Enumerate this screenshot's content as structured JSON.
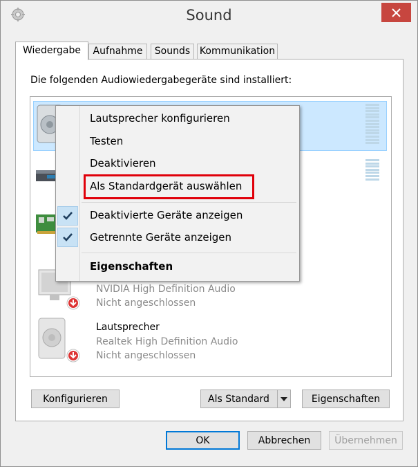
{
  "window": {
    "title": "Sound"
  },
  "tabs": [
    {
      "label": "Wiedergabe",
      "active": true
    },
    {
      "label": "Aufnahme"
    },
    {
      "label": "Sounds"
    },
    {
      "label": "Kommunikation"
    }
  ],
  "panel": {
    "description": "Die folgenden Audiowiedergabegeräte sind installiert:"
  },
  "devices": [
    {
      "name": "Lautsprecher",
      "vendor": "NVIDIA High Definition Audio",
      "status": "Nicht angeschlossen",
      "icon": "monitor-speaker-icon"
    },
    {
      "name": "Lautsprecher",
      "vendor": "Realtek High Definition Audio",
      "status": "Nicht angeschlossen",
      "icon": "speaker-icon"
    }
  ],
  "context_menu": {
    "items": [
      {
        "label": "Lautsprecher konfigurieren"
      },
      {
        "label": "Testen"
      },
      {
        "label": "Deaktivieren"
      },
      {
        "label": "Als Standardgerät auswählen",
        "highlighted": true
      },
      {
        "label": "Deaktivierte Geräte anzeigen",
        "checked": true
      },
      {
        "label": "Getrennte Geräte anzeigen",
        "checked": true
      },
      {
        "label": "Eigenschaften",
        "bold": true
      }
    ]
  },
  "buttons": {
    "configure": "Konfigurieren",
    "set_default": "Als Standard",
    "properties": "Eigenschaften",
    "ok": "OK",
    "cancel": "Abbrechen",
    "apply": "Übernehmen"
  },
  "colors": {
    "close_red": "#c7463f",
    "selection": "#cce8ff",
    "highlight_box": "#e0000a",
    "check_bg": "#c8e2f5"
  }
}
